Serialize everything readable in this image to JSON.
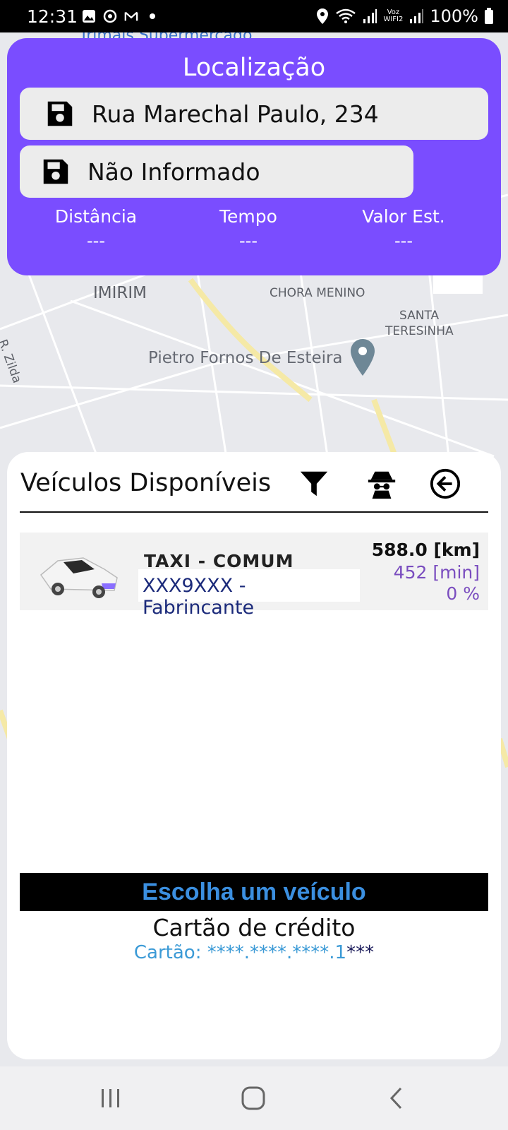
{
  "status_bar": {
    "time": "12:31",
    "battery": "100%",
    "voz": "Voz",
    "wifi2": "WIFI2",
    "icons": [
      "gallery-icon",
      "sync-icon",
      "gmail-icon",
      "dot-icon",
      "location-icon",
      "wifi-icon",
      "signal-icon",
      "signal-icon",
      "battery-icon"
    ]
  },
  "map": {
    "labels": {
      "poi_top": "Trimais Supermercado",
      "imirim": "IMIRIM",
      "chora": "CHORA MENINO",
      "santa": "SANTA",
      "teresinha": "TERESINHA",
      "pietro": "Pietro Fornos De Esteira",
      "zilda": "R. Zilda"
    }
  },
  "location_card": {
    "title": "Localização",
    "origin": "Rua Marechal Paulo, 234",
    "destination": "Não Informado",
    "stats": {
      "distance_label": "Distância",
      "distance_value": "---",
      "time_label": "Tempo",
      "time_value": "---",
      "price_label": "Valor Est.",
      "price_value": "---"
    },
    "colors": {
      "background": "#7a4dff"
    }
  },
  "vehicles_sheet": {
    "title": "Veículos Disponíveis",
    "icons": [
      "filter-icon",
      "incognito-icon",
      "back-circle-icon"
    ],
    "vehicles": [
      {
        "category": "TAXI - COMUM",
        "plate": "XXX9XXX - Fabrincante",
        "distance": "588.0 [km]",
        "time": "452 [min]",
        "percent": "0 %"
      }
    ],
    "choose_label": "Escolha um veículo",
    "payment_title": "Cartão de crédito",
    "card_prefix": "Cartão: ****.****.****.1",
    "card_suffix": "***"
  },
  "nav_bar": {
    "icons": [
      "recents-icon",
      "home-icon",
      "back-icon"
    ]
  }
}
